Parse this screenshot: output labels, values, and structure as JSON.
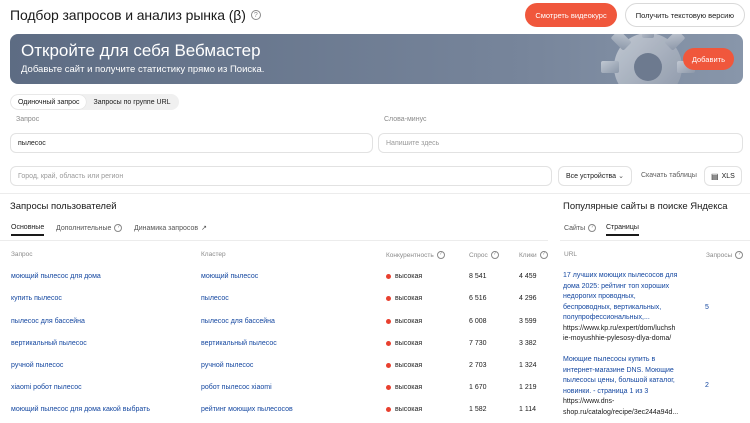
{
  "header": {
    "title": "Подбор запросов и анализ рынка (β)",
    "video_button": "Смотреть видеокурс",
    "text_version_button": "Получить текстовую версию"
  },
  "banner": {
    "title": "Откройте для себя Вебмастер",
    "subtitle": "Добавьте сайт и получите статистику прямо из Поиска.",
    "add_button": "Добавить"
  },
  "mode_tabs": [
    "Одиночный запрос",
    "Запросы по группе URL"
  ],
  "query": {
    "label": "Запрос",
    "value": "пылесос"
  },
  "minus_words": {
    "label": "Слова-минус",
    "placeholder": "Напишите здесь"
  },
  "region": {
    "placeholder": "Город, край, область или регион"
  },
  "devices_select": "Все устройства",
  "download_link": "Скачать таблицы",
  "xls_button": "XLS",
  "user_queries": {
    "title": "Запросы пользователей",
    "tabs": [
      "Основные",
      "Дополнительные",
      "Динамика запросов"
    ],
    "columns": [
      "Запрос",
      "Кластер",
      "Конкурентность",
      "Спрос",
      "Клики"
    ],
    "rows": [
      {
        "query": "моющий пылесос для дома",
        "cluster": "моющий пылесос",
        "competition": "высокая",
        "demand": "8 541",
        "clicks": "4 459"
      },
      {
        "query": "купить пылесос",
        "cluster": "пылесос",
        "competition": "высокая",
        "demand": "6 516",
        "clicks": "4 296"
      },
      {
        "query": "пылесос для бассейна",
        "cluster": "пылесос для бассейна",
        "competition": "высокая",
        "demand": "6 008",
        "clicks": "3 599"
      },
      {
        "query": "вертикальный пылесос",
        "cluster": "вертикальный пылесос",
        "competition": "высокая",
        "demand": "7 730",
        "clicks": "3 382"
      },
      {
        "query": "ручной пылесос",
        "cluster": "ручной пылесос",
        "competition": "высокая",
        "demand": "2 703",
        "clicks": "1 324"
      },
      {
        "query": "xiaomi робот пылесос",
        "cluster": "робот пылесос xiaomi",
        "competition": "высокая",
        "demand": "1 670",
        "clicks": "1 219"
      },
      {
        "query": "моющий пылесос для дома какой выбрать",
        "cluster": "рейтинг моющих пылесосов",
        "competition": "высокая",
        "demand": "1 582",
        "clicks": "1 114"
      }
    ]
  },
  "popular_sites": {
    "title": "Популярные сайты в поиске Яндекса",
    "tabs": [
      "Сайты",
      "Страницы"
    ],
    "columns": [
      "URL",
      "Запросы"
    ],
    "rows": [
      {
        "title_lines": [
          "17 лучших моющих пылесосов для",
          "дома 2025: рейтинг топ хороших",
          "недорогих проводных,",
          "беспроводных, вертикальных,",
          "полупрофессиональных,..."
        ],
        "url_lines": [
          "https://www.kp.ru/expert/dom/luchsh",
          "ie-moyushhie-pylesosy-dlya-doma/"
        ],
        "count": "5"
      },
      {
        "title_lines": [
          "Моющие пылесосы купить в",
          "интернет-магазине DNS. Моющие",
          "пылесосы цены, большой каталог,",
          "новинки. - страница 1 из 3"
        ],
        "url_lines": [
          "https://www.dns-",
          "shop.ru/catalog/recipe/3ec244a94d..."
        ],
        "count": "2"
      }
    ]
  }
}
